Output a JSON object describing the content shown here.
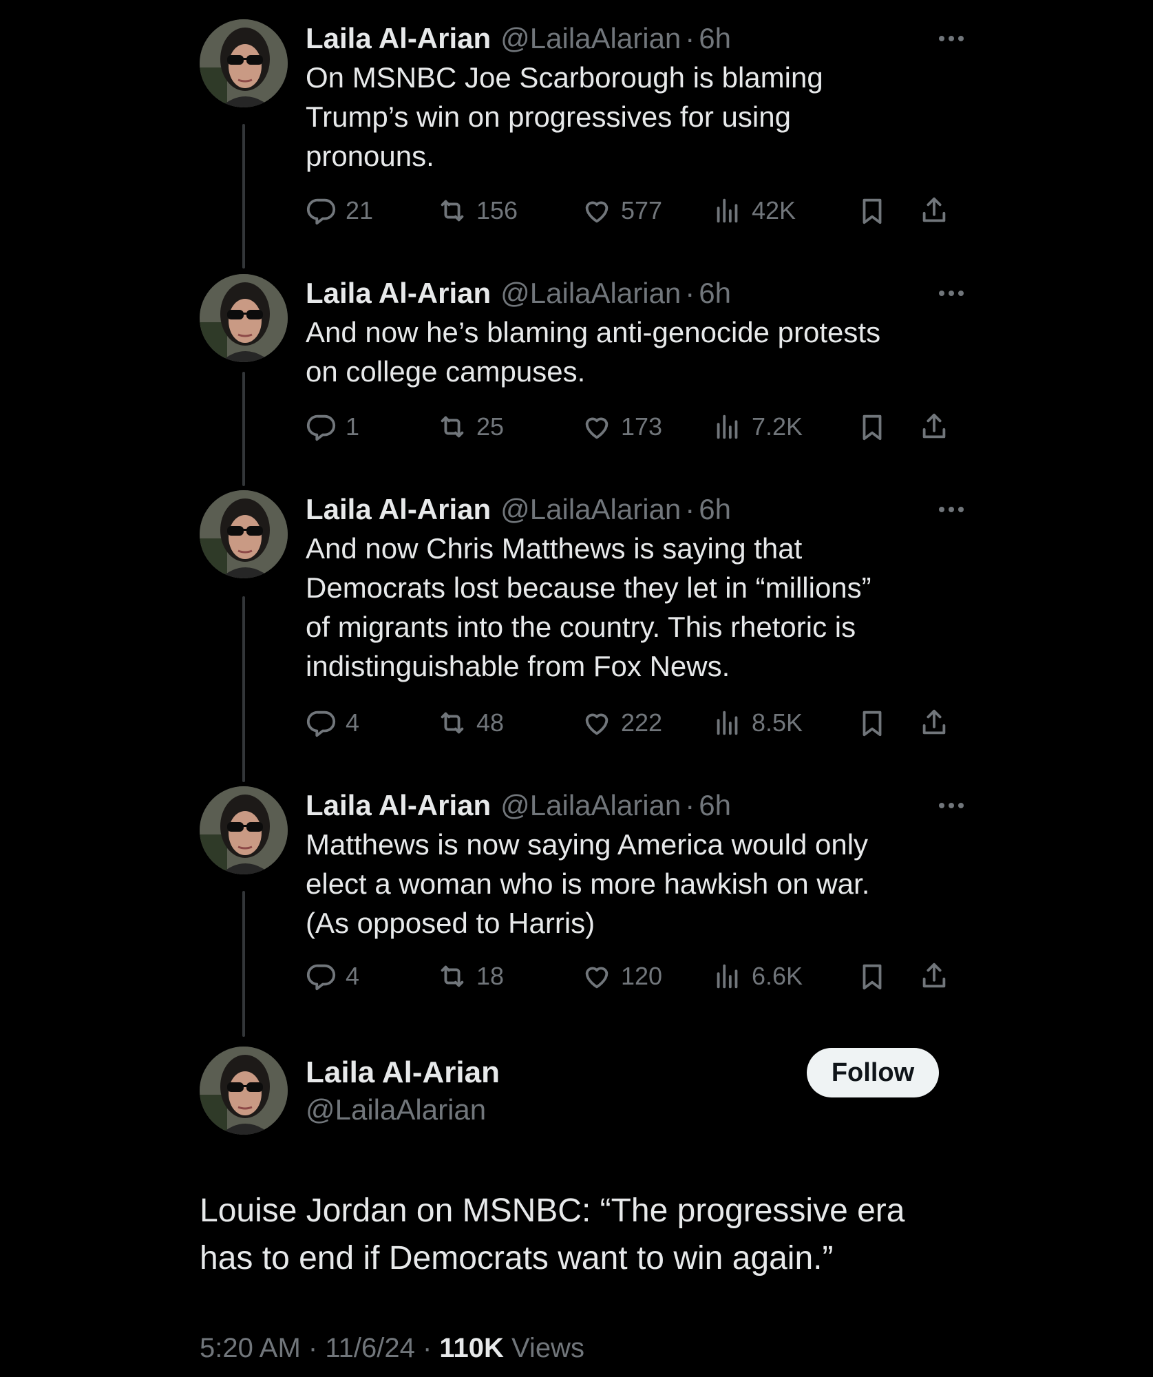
{
  "thread": [
    {
      "name": "Laila Al-Arian",
      "handle": "@LailaAlarian",
      "time": "6h",
      "text": "On MSNBC Joe Scarborough is blaming\nTrump’s win on progressives for using\npronouns.",
      "replies": "21",
      "reposts": "156",
      "likes": "577",
      "views": "42K"
    },
    {
      "name": "Laila Al-Arian",
      "handle": "@LailaAlarian",
      "time": "6h",
      "text": "And now he’s blaming anti-genocide protests\non college campuses.",
      "replies": "1",
      "reposts": "25",
      "likes": "173",
      "views": "7.2K"
    },
    {
      "name": "Laila Al-Arian",
      "handle": "@LailaAlarian",
      "time": "6h",
      "text": "And now Chris Matthews is saying that\nDemocrats lost because they let in “millions”\nof migrants into the country. This rhetoric is\nindistinguishable from Fox News.",
      "replies": "4",
      "reposts": "48",
      "likes": "222",
      "views": "8.5K"
    },
    {
      "name": "Laila Al-Arian",
      "handle": "@LailaAlarian",
      "time": "6h",
      "text": "Matthews is now saying America would only\nelect a woman who is more hawkish on war.\n(As opposed to Harris)",
      "replies": "4",
      "reposts": "18",
      "likes": "120",
      "views": "6.6K"
    }
  ],
  "main": {
    "name": "Laila Al-Arian",
    "handle": "@LailaAlarian",
    "follow_label": "Follow",
    "text": "Louise Jordan on MSNBC: “The progressive era\nhas to end if Democrats want to win again.”",
    "time": "5:20 AM",
    "date": "11/6/24",
    "views_count": "110K",
    "views_label": "Views"
  },
  "separator": "·",
  "icons": {
    "reply": "reply-icon",
    "repost": "repost-icon",
    "like": "heart-icon",
    "views": "views-icon",
    "bookmark": "bookmark-icon",
    "share": "share-icon",
    "more": "more-icon"
  },
  "colors": {
    "background": "#000000",
    "text": "#e7e9ea",
    "muted": "#71767b",
    "thread_line": "#333639",
    "follow_bg": "#eff3f4"
  }
}
